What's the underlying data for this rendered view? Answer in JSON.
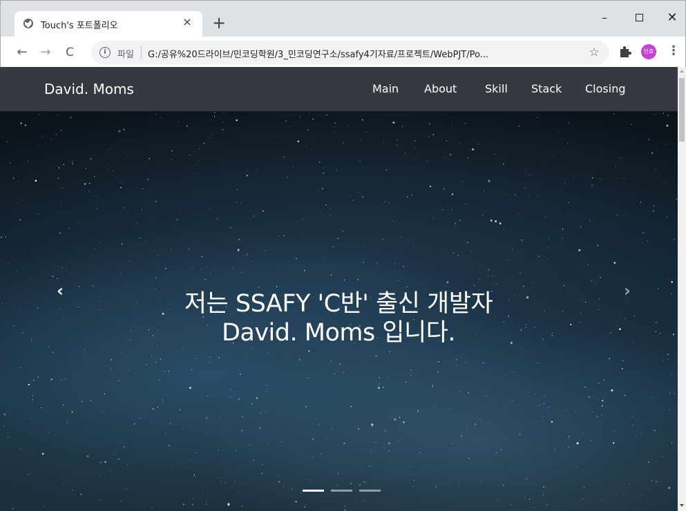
{
  "browser": {
    "tab_title": "Touch's 포트폴리오",
    "tab_close": "×",
    "new_tab": "+",
    "window_minimize": "–",
    "window_close": "✕",
    "back": "←",
    "forward": "→",
    "reload": "C",
    "scheme_label": "파일",
    "url": "G:/공유%20드라이브/민코딩학원/3_민코딩연구소/ssafy4기자료/프로젝트/WebPJT/Po...",
    "bookmark_star": "☆",
    "profile_initials": "인호",
    "menu": "⋮"
  },
  "site": {
    "brand": "David. Moms",
    "nav": [
      {
        "label": "Main"
      },
      {
        "label": "About"
      },
      {
        "label": "Skill"
      },
      {
        "label": "Stack"
      },
      {
        "label": "Closing"
      }
    ]
  },
  "hero": {
    "line1": "저는 SSAFY 'C반' 출신 개발자",
    "line2": "David. Moms 입니다.",
    "prev": "‹",
    "next": "›",
    "slide_count": 3,
    "active_slide": 1
  },
  "colors": {
    "site_nav_bg": "#353a40",
    "profile_bg": "#c344d2"
  }
}
